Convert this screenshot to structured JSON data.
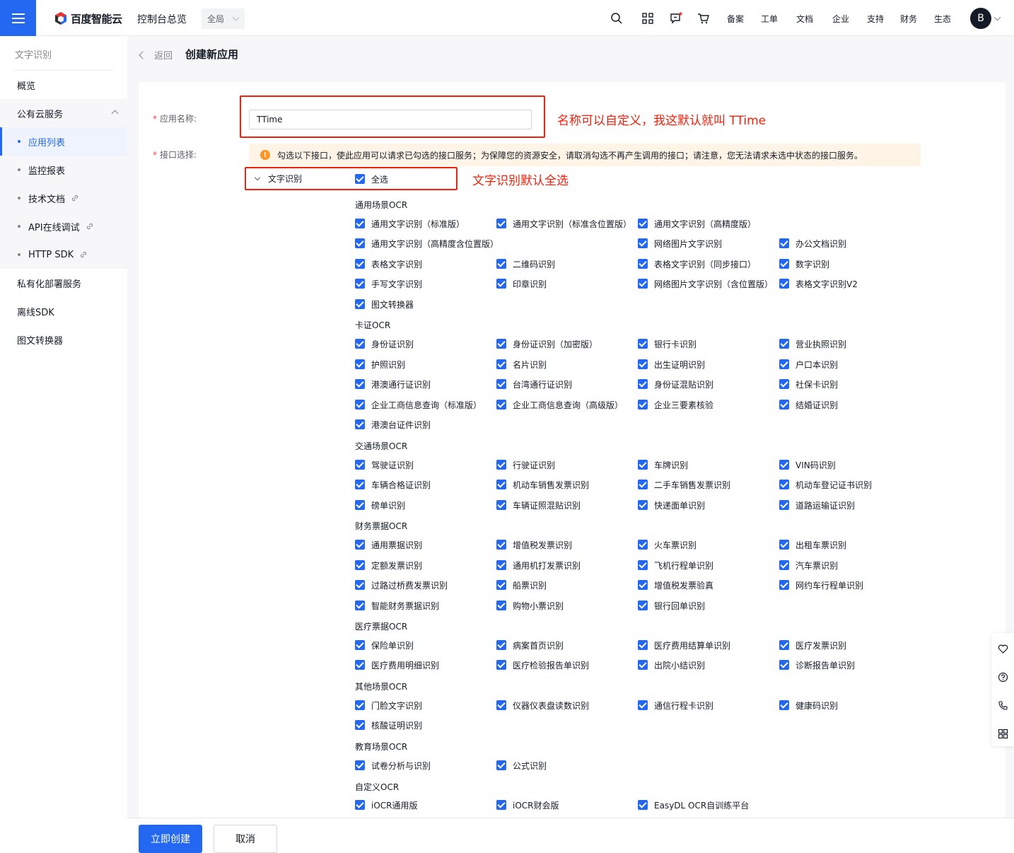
{
  "topbar": {
    "brand": "百度智能云",
    "console": "控制台总览",
    "scope": "全局",
    "nav": [
      "备案",
      "工单",
      "文档",
      "企业",
      "支持",
      "财务",
      "生态"
    ],
    "avatar": "B"
  },
  "sidebar": {
    "title": "文字识别",
    "items": [
      {
        "label": "概览"
      },
      {
        "label": "公有云服务"
      },
      {
        "label": "应用列表"
      },
      {
        "label": "监控报表"
      },
      {
        "label": "技术文档"
      },
      {
        "label": "API在线调试"
      },
      {
        "label": "HTTP SDK"
      },
      {
        "label": "私有化部署服务"
      },
      {
        "label": "离线SDK"
      },
      {
        "label": "图文转换器"
      }
    ]
  },
  "header": {
    "back": "返回",
    "title": "创建新应用"
  },
  "form": {
    "name_label": "应用名称:",
    "name_value": "TTime",
    "name_annotation": "名称可以自定义，我这默认就叫 TTime",
    "api_label": "接口选择:",
    "warning": "勾选以下接口，使此应用可以请求已勾选的接口服务；为保障您的资源安全，请取消勾选不再产生调用的接口；请注意，您无法请求未选中状态的接口服务。",
    "group": "文字识别",
    "select_all": "全选",
    "select_annotation": "文字识别默认全选"
  },
  "sections": [
    {
      "title": "通用场景OCR",
      "items": [
        "通用文字识别（标准版）",
        "通用文字识别（标准含位置版）",
        "通用文字识别（高精度版）",
        "通用文字识别（高精度含位置版）",
        "网络图片文字识别",
        "办公文档识别",
        "表格文字识别",
        "二维码识别",
        "表格文字识别（同步接口）",
        "数字识别",
        "手写文字识别",
        "印章识别",
        "网络图片文字识别（含位置版）",
        "表格文字识别V2",
        "图文转换器"
      ]
    },
    {
      "title": "卡证OCR",
      "items": [
        "身份证识别",
        "身份证识别（加密版）",
        "银行卡识别",
        "营业执照识别",
        "护照识别",
        "名片识别",
        "出生证明识别",
        "户口本识别",
        "港澳通行证识别",
        "台湾通行证识别",
        "身份证混贴识别",
        "社保卡识别",
        "企业工商信息查询（标准版）",
        "企业工商信息查询（高级版）",
        "企业三要素核验",
        "结婚证识别",
        "港澳台证件识别"
      ]
    },
    {
      "title": "交通场景OCR",
      "items": [
        "驾驶证识别",
        "行驶证识别",
        "车牌识别",
        "VIN码识别",
        "车辆合格证识别",
        "机动车销售发票识别",
        "二手车销售发票识别",
        "机动车登记证书识别",
        "磅单识别",
        "车辆证照混贴识别",
        "快递面单识别",
        "道路运输证识别"
      ]
    },
    {
      "title": "财务票据OCR",
      "items": [
        "通用票据识别",
        "增值税发票识别",
        "火车票识别",
        "出租车票识别",
        "定额发票识别",
        "通用机打发票识别",
        "飞机行程单识别",
        "汽车票识别",
        "过路过桥费发票识别",
        "船票识别",
        "增值税发票验真",
        "网约车行程单识别",
        "智能财务票据识别",
        "购物小票识别",
        "银行回单识别"
      ]
    },
    {
      "title": "医疗票据OCR",
      "items": [
        "保险单识别",
        "病案首页识别",
        "医疗费用结算单识别",
        "医疗发票识别",
        "医疗费用明细识别",
        "医疗检验报告单识别",
        "出院小结识别",
        "诊断报告单识别"
      ]
    },
    {
      "title": "其他场景OCR",
      "items": [
        "门脸文字识别",
        "仪器仪表盘读数识别",
        "通信行程卡识别",
        "健康码识别",
        "核酸证明识别"
      ]
    },
    {
      "title": "教育场景OCR",
      "items": [
        "试卷分析与识别",
        "公式识别"
      ]
    },
    {
      "title": "自定义OCR",
      "items": [
        "iOCR通用版",
        "iOCR财会版",
        "EasyDL OCR自训练平台"
      ]
    }
  ],
  "footer": {
    "create": "立即创建",
    "cancel": "取消"
  },
  "colors": {
    "primary": "#2468f2",
    "annotation": "#f2210b",
    "warning_bg": "#fff4e6"
  }
}
